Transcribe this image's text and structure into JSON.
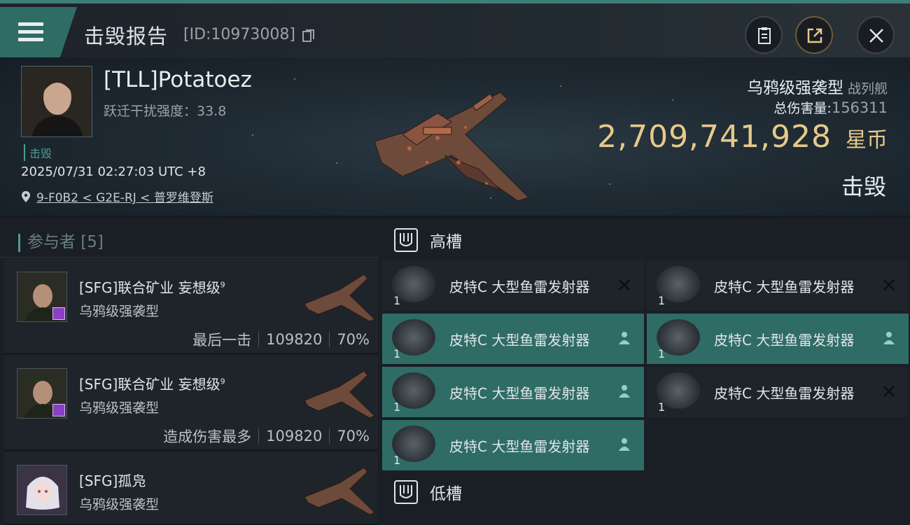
{
  "header": {
    "title": "击毁报告",
    "report_id": "[ID:10973008]",
    "buttons": {
      "menu": "menu-icon",
      "clipboard": "clipboard-icon",
      "share": "share-icon",
      "close": "close-icon"
    }
  },
  "victim": {
    "pilot": "[TLL]Potatoez",
    "warp_disruption": "跃迁干扰强度：33.8",
    "tag": "击毁",
    "datetime": "2025/07/31 02:27:03 UTC +8",
    "location": "9-F0B2 < G2E-RJ < 普罗维登斯",
    "ship_name": "乌鸦级强袭型",
    "ship_class": "战列舰",
    "damage_label": "总伤害量:",
    "damage_value": "156311",
    "isk_value": "2,709,741,928",
    "isk_unit": "星币",
    "status": "击毁"
  },
  "participants": {
    "header": "参与者 [5]",
    "items": [
      {
        "name": "[SFG]联合矿业 妄想级",
        "level": "9",
        "ship": "乌鸦级强袭型",
        "role": "最后一击",
        "damage": "109820",
        "percent": "70%"
      },
      {
        "name": "[SFG]联合矿业 妄想级",
        "level": "9",
        "ship": "乌鸦级强袭型",
        "role": "造成伤害最多",
        "damage": "109820",
        "percent": "70%"
      },
      {
        "name": "[SFG]孤凫",
        "level": "",
        "ship": "乌鸦级强袭型",
        "role": "",
        "damage": "",
        "percent": ""
      }
    ]
  },
  "fitting": {
    "high_label": "高槽",
    "low_label": "低槽",
    "high_slots": [
      {
        "name": "皮特C 大型鱼雷发射器",
        "qty": "1",
        "state": "destroyed"
      },
      {
        "name": "皮特C 大型鱼雷发射器",
        "qty": "1",
        "state": "destroyed"
      },
      {
        "name": "皮特C 大型鱼雷发射器",
        "qty": "1",
        "state": "dropped"
      },
      {
        "name": "皮特C 大型鱼雷发射器",
        "qty": "1",
        "state": "dropped"
      },
      {
        "name": "皮特C 大型鱼雷发射器",
        "qty": "1",
        "state": "dropped"
      },
      {
        "name": "皮特C 大型鱼雷发射器",
        "qty": "1",
        "state": "destroyed"
      },
      {
        "name": "皮特C 大型鱼雷发射器",
        "qty": "1",
        "state": "dropped"
      }
    ]
  },
  "colors": {
    "accent": "#2f6c66",
    "gold": "#e7c98a",
    "bg": "#1a1f25"
  }
}
